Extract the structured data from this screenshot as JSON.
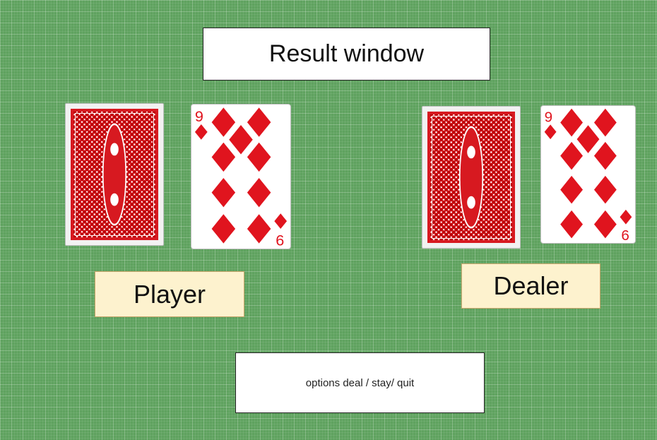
{
  "result_window": {
    "text": "Result window"
  },
  "player": {
    "label": "Player",
    "cards": [
      {
        "face_down": true
      },
      {
        "rank": "9",
        "suit": "diamonds",
        "corner_bottom": "6"
      }
    ]
  },
  "dealer": {
    "label": "Dealer",
    "cards": [
      {
        "face_down": true
      },
      {
        "rank": "9",
        "suit": "diamonds",
        "corner_bottom": "6"
      }
    ]
  },
  "options": {
    "text": "options deal / stay/ quit"
  },
  "colors": {
    "table_green": "#5fa25f",
    "card_red": "#e0141e",
    "label_bg": "#fdf2ce"
  }
}
